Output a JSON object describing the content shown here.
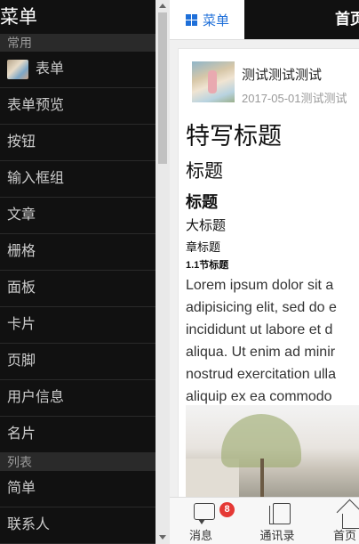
{
  "sidebar": {
    "title": "菜单",
    "groups": [
      {
        "label": "常用"
      },
      {
        "label": "列表"
      }
    ],
    "items": [
      {
        "label": "表单"
      },
      {
        "label": "表单预览"
      },
      {
        "label": "按钮"
      },
      {
        "label": "输入框组"
      },
      {
        "label": "文章"
      },
      {
        "label": "栅格"
      },
      {
        "label": "面板"
      },
      {
        "label": "卡片"
      },
      {
        "label": "页脚"
      },
      {
        "label": "用户信息"
      },
      {
        "label": "名片"
      },
      {
        "label": "简单"
      },
      {
        "label": "联系人"
      }
    ]
  },
  "header": {
    "menu_label": "菜单",
    "title": "首页"
  },
  "article": {
    "author_name": "测试测试测试",
    "meta": "2017-05-01测试测试",
    "h1": "特写标题",
    "h2": "标题",
    "h3": "标题",
    "h4": "大标题",
    "h5": "章标题",
    "h6": "1.1节标题",
    "paragraph_lines": [
      "Lorem ipsum dolor sit a",
      "adipisicing elit, sed do e",
      "incididunt ut labore et d",
      "aliqua. Ut enim ad minir",
      "nostrud exercitation ulla",
      "aliquip ex ea commodo"
    ]
  },
  "tabbar": {
    "tabs": [
      {
        "label": "消息",
        "icon": "message-icon",
        "badge": "8"
      },
      {
        "label": "通讯录",
        "icon": "contacts-icon"
      },
      {
        "label": "首页",
        "icon": "home-icon"
      }
    ]
  },
  "colors": {
    "accent": "#1e6fd9",
    "badge": "#e53935",
    "sidebar_bg": "#111111"
  }
}
